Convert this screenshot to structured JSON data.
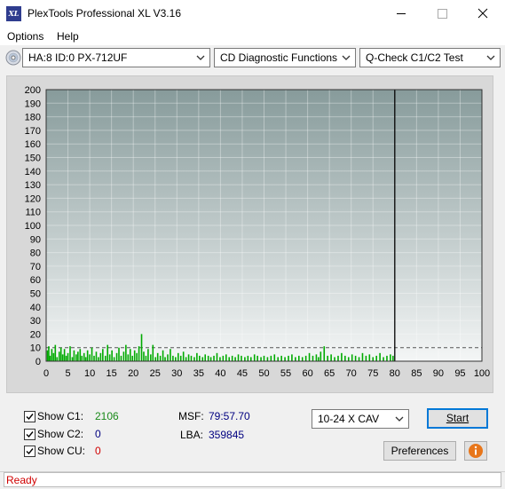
{
  "window": {
    "title": "PlexTools Professional XL V3.16",
    "app_icon_text": "XL"
  },
  "menu": {
    "options": "Options",
    "help": "Help"
  },
  "toolbar": {
    "drive": "HA:8 ID:0  PX-712UF",
    "function": "CD Diagnostic Functions",
    "test": "Q-Check C1/C2 Test"
  },
  "chart_data": {
    "type": "bar",
    "x_ticks": [
      "0",
      "5",
      "10",
      "15",
      "20",
      "25",
      "30",
      "35",
      "40",
      "45",
      "50",
      "55",
      "60",
      "65",
      "70",
      "75",
      "80",
      "85",
      "90",
      "95",
      "100"
    ],
    "y_ticks": [
      "0",
      "10",
      "20",
      "30",
      "40",
      "50",
      "60",
      "70",
      "80",
      "90",
      "100",
      "110",
      "120",
      "130",
      "140",
      "150",
      "160",
      "170",
      "180",
      "190",
      "200"
    ],
    "xlim": [
      0,
      100
    ],
    "ylim": [
      0,
      200
    ],
    "end_marker_x": 80,
    "dashed_reference_y": 10,
    "series": [
      {
        "color": "#00aa00",
        "x": [
          0.3,
          0.6,
          0.9,
          1.3,
          1.7,
          2.1,
          2.5,
          3.0,
          3.4,
          3.8,
          4.2,
          4.6,
          5.0,
          5.5,
          6.0,
          6.4,
          6.9,
          7.3,
          7.8,
          8.2,
          8.7,
          9.1,
          9.5,
          10.0,
          10.5,
          11.0,
          11.5,
          12.0,
          12.5,
          13.0,
          13.6,
          14.1,
          14.6,
          15.1,
          15.6,
          16.2,
          16.7,
          17.2,
          17.8,
          18.3,
          18.8,
          19.3,
          19.8,
          20.3,
          20.8,
          21.3,
          21.9,
          22.4,
          22.9,
          23.4,
          24.0,
          24.5,
          25.1,
          25.6,
          26.2,
          26.8,
          27.3,
          27.9,
          28.5,
          29.1,
          29.7,
          30.3,
          30.9,
          31.5,
          32.1,
          32.7,
          33.3,
          34.0,
          34.6,
          35.2,
          35.9,
          36.5,
          37.2,
          37.8,
          38.5,
          39.2,
          39.9,
          40.6,
          41.3,
          42.0,
          42.7,
          43.4,
          44.1,
          44.8,
          45.6,
          46.3,
          47.0,
          47.8,
          48.5,
          49.3,
          50.0,
          50.8,
          51.6,
          52.4,
          53.2,
          54.0,
          54.8,
          55.6,
          56.4,
          57.2,
          58.0,
          58.8,
          59.6,
          60.4,
          61.2,
          62.0,
          62.5,
          63.0,
          63.8,
          64.6,
          65.4,
          66.2,
          67.0,
          67.8,
          68.6,
          69.4,
          70.2,
          71.0,
          71.8,
          72.6,
          73.4,
          74.2,
          75.0,
          75.8,
          76.6,
          77.4,
          78.2,
          79.0,
          79.6
        ],
        "y": [
          8,
          11,
          4,
          9,
          6,
          12,
          3,
          7,
          10,
          5,
          9,
          4,
          6,
          11,
          3,
          8,
          5,
          7,
          9,
          4,
          6,
          3,
          8,
          5,
          10,
          4,
          7,
          3,
          6,
          9,
          4,
          12,
          5,
          8,
          3,
          6,
          10,
          4,
          7,
          12,
          5,
          9,
          4,
          8,
          6,
          11,
          20,
          7,
          4,
          9,
          5,
          12,
          3,
          6,
          4,
          8,
          3,
          5,
          9,
          4,
          3,
          6,
          4,
          7,
          3,
          5,
          4,
          3,
          6,
          4,
          3,
          5,
          4,
          3,
          4,
          6,
          3,
          4,
          5,
          3,
          4,
          3,
          5,
          4,
          3,
          4,
          3,
          5,
          4,
          3,
          4,
          3,
          4,
          5,
          3,
          4,
          3,
          4,
          5,
          3,
          4,
          3,
          4,
          6,
          4,
          5,
          3,
          7,
          11,
          4,
          5,
          3,
          4,
          6,
          4,
          3,
          5,
          4,
          3,
          6,
          4,
          5,
          3,
          4,
          6,
          3,
          4,
          5,
          4
        ]
      }
    ]
  },
  "controls": {
    "show_c1_label": "Show C1:",
    "show_c1_value": "2106",
    "show_c2_label": "Show C2:",
    "show_c2_value": "0",
    "show_cu_label": "Show CU:",
    "show_cu_value": "0",
    "msf_label": "MSF:",
    "msf_value": "79:57.70",
    "lba_label": "LBA:",
    "lba_value": "359845",
    "speed": "10-24 X CAV",
    "start_label": "Start",
    "preferences_label": "Preferences"
  },
  "status": {
    "text": "Ready"
  },
  "colors": {
    "plot_bg_top": "#879b9b",
    "plot_bg_bottom": "#f4f6f6",
    "series_c1": "#00aa00",
    "status_text": "#d00000"
  }
}
